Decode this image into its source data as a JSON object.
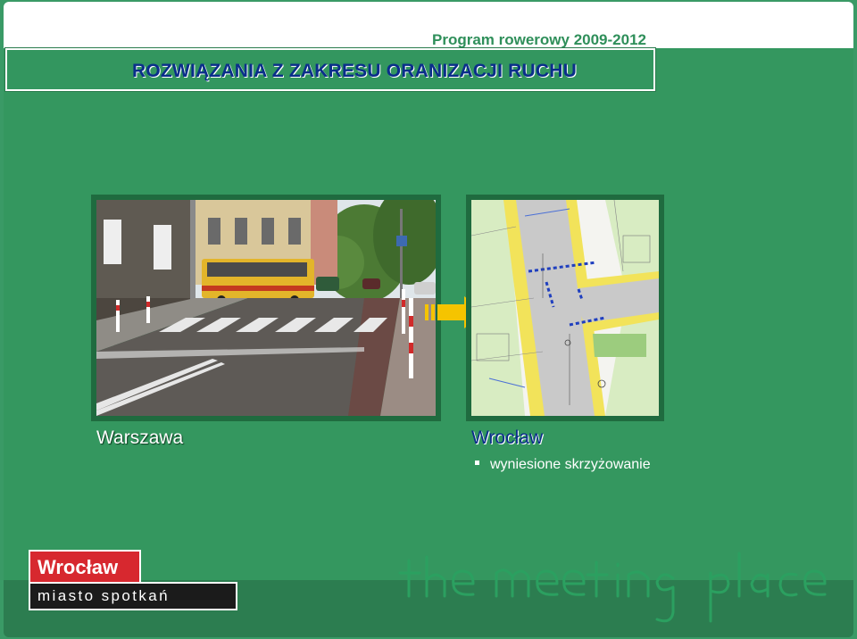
{
  "header": {
    "program": "Program rowerowy 2009-2012",
    "title": "ROZWIĄZANIA Z ZAKRESU ORANIZACJI RUCHU"
  },
  "left_panel": {
    "city": "Warszawa"
  },
  "right_panel": {
    "city": "Wrocław",
    "bullets": [
      "wyniesione skrzyżowanie"
    ]
  },
  "footer": {
    "logo_top": "Wrocław",
    "logo_bottom": "miasto spotkań",
    "tagline": "the meeting place"
  },
  "colors": {
    "background": "#34975f",
    "title": "#0a2e8a",
    "logo_red": "#d7282f",
    "arrow": "#f5c400"
  },
  "icons": {
    "arrow": "arrow-right-icon",
    "bullet": "square-bullet-icon"
  }
}
